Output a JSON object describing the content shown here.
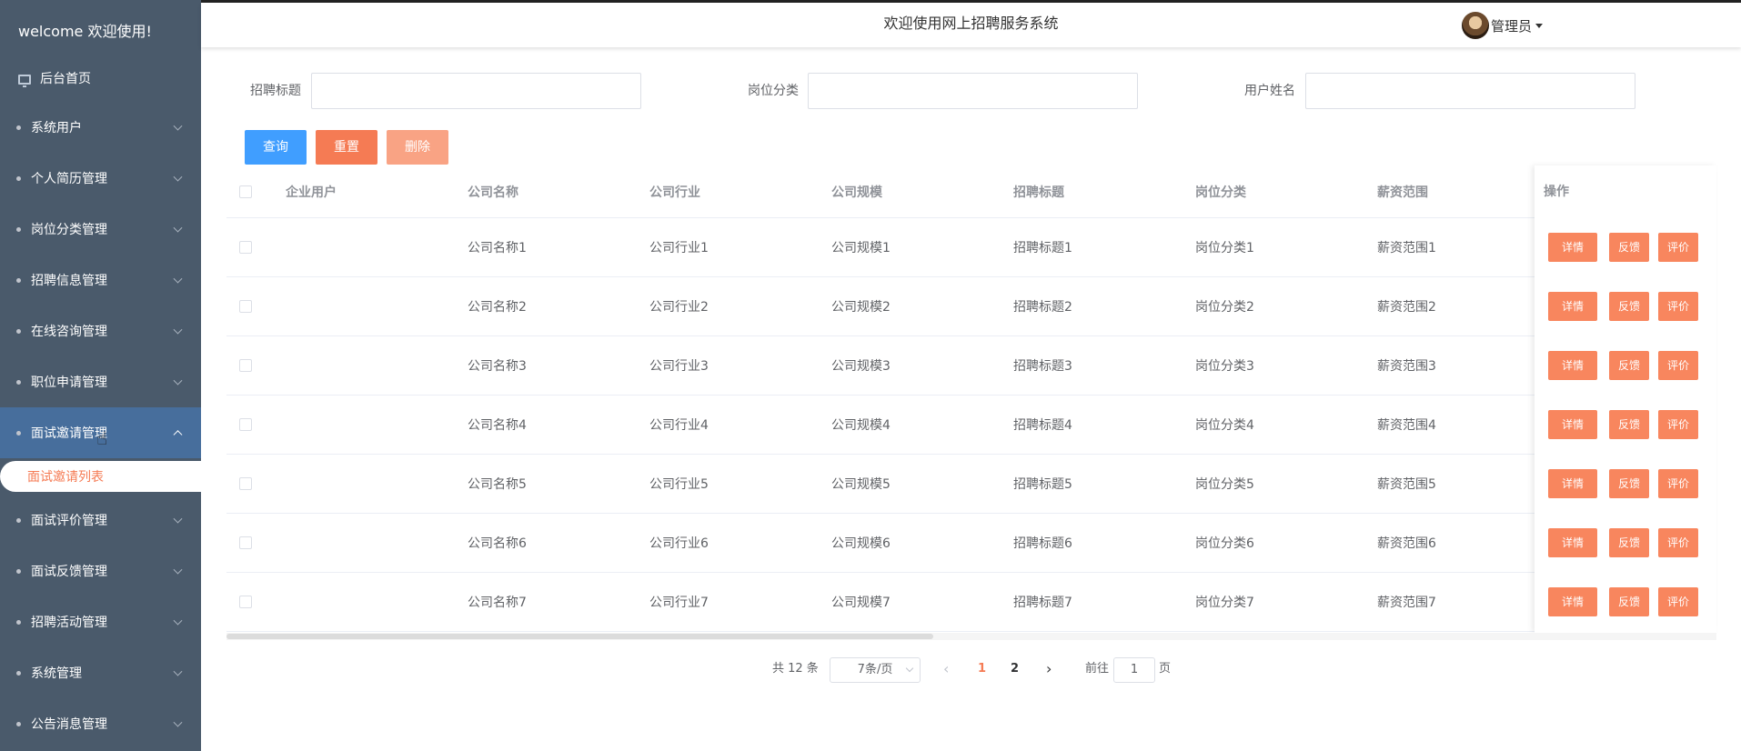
{
  "sidebar": {
    "welcome": "welcome 欢迎使用!",
    "home": "后台首页",
    "items": [
      {
        "label": "系统用户"
      },
      {
        "label": "个人简历管理"
      },
      {
        "label": "岗位分类管理"
      },
      {
        "label": "招聘信息管理"
      },
      {
        "label": "在线咨询管理"
      },
      {
        "label": "职位申请管理"
      },
      {
        "label": "面试邀请管理"
      },
      {
        "label": "面试评价管理"
      },
      {
        "label": "面试反馈管理"
      },
      {
        "label": "招聘活动管理"
      },
      {
        "label": "系统管理"
      },
      {
        "label": "公告消息管理"
      }
    ],
    "active_index": 6,
    "submenu_label": "面试邀请列表"
  },
  "header": {
    "title": "欢迎使用网上招聘服务系统",
    "user": "管理员"
  },
  "search": {
    "title_label": "招聘标题",
    "category_label": "岗位分类",
    "username_label": "用户姓名"
  },
  "buttons": {
    "query": "查询",
    "reset": "重置",
    "delete": "删除"
  },
  "colors": {
    "sidebar_bg": "#4a5a6b",
    "active_bg": "#476e9c",
    "accent": "#f57b54",
    "query_btn": "#409eff",
    "reset_btn": "#f57b54",
    "delete_btn": "#f9a384",
    "op_btn": "#f8865e"
  },
  "table": {
    "columns": [
      "企业用户",
      "公司名称",
      "公司行业",
      "公司规模",
      "招聘标题",
      "岗位分类",
      "薪资范围",
      "操作"
    ],
    "rows": [
      {
        "user": "",
        "name": "公司名称1",
        "industry": "公司行业1",
        "scale": "公司规模1",
        "title": "招聘标题1",
        "category": "岗位分类1",
        "salary": "薪资范围1"
      },
      {
        "user": "",
        "name": "公司名称2",
        "industry": "公司行业2",
        "scale": "公司规模2",
        "title": "招聘标题2",
        "category": "岗位分类2",
        "salary": "薪资范围2"
      },
      {
        "user": "",
        "name": "公司名称3",
        "industry": "公司行业3",
        "scale": "公司规模3",
        "title": "招聘标题3",
        "category": "岗位分类3",
        "salary": "薪资范围3"
      },
      {
        "user": "",
        "name": "公司名称4",
        "industry": "公司行业4",
        "scale": "公司规模4",
        "title": "招聘标题4",
        "category": "岗位分类4",
        "salary": "薪资范围4"
      },
      {
        "user": "",
        "name": "公司名称5",
        "industry": "公司行业5",
        "scale": "公司规模5",
        "title": "招聘标题5",
        "category": "岗位分类5",
        "salary": "薪资范围5"
      },
      {
        "user": "",
        "name": "公司名称6",
        "industry": "公司行业6",
        "scale": "公司规模6",
        "title": "招聘标题6",
        "category": "岗位分类6",
        "salary": "薪资范围6"
      },
      {
        "user": "",
        "name": "公司名称7",
        "industry": "公司行业7",
        "scale": "公司规模7",
        "title": "招聘标题7",
        "category": "岗位分类7",
        "salary": "薪资范围7"
      }
    ],
    "row_actions": {
      "detail": "详情",
      "feedback": "反馈",
      "review": "评价"
    }
  },
  "pagination": {
    "total": "共 12 条",
    "page_size": "7条/页",
    "pages": [
      "1",
      "2"
    ],
    "current": "1",
    "goto_prefix": "前往",
    "goto_value": "1",
    "goto_suffix": "页"
  }
}
